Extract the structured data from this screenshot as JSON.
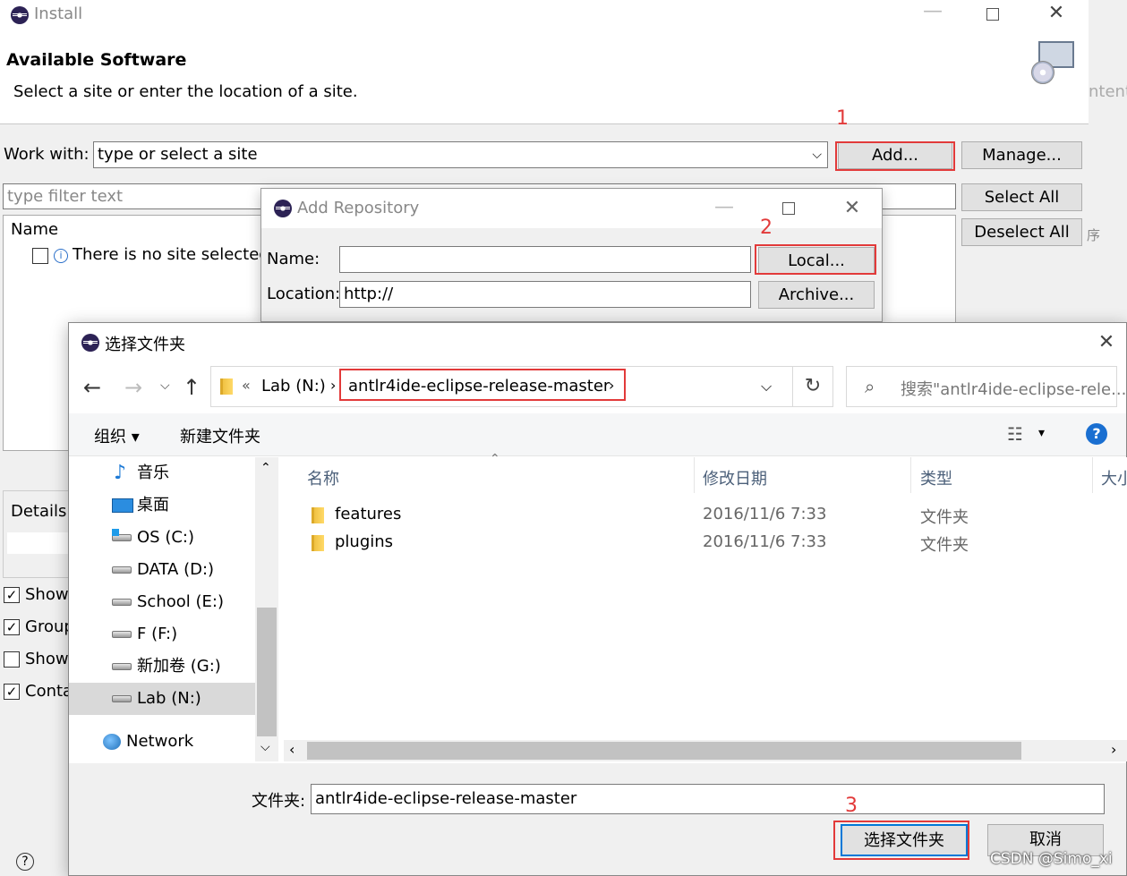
{
  "install": {
    "title": "Install",
    "heading": "Available Software",
    "subheading": "Select a site or enter the location of a site.",
    "work_with_label": "Work with:",
    "work_with_value": "type or select a site",
    "filter_placeholder": "type filter text",
    "add_label": "Add...",
    "manage_label": "Manage...",
    "select_all_label": "Select All",
    "deselect_all_label": "Deselect All",
    "tree_header": "Name",
    "tree_item": "There is no site selected.",
    "details_label": "Details",
    "options": [
      {
        "label": "Show",
        "checked": true
      },
      {
        "label": "Group",
        "checked": true
      },
      {
        "label": "Show",
        "checked": false
      },
      {
        "label": "Conta",
        "checked": true
      }
    ],
    "bg_fragment_1": "ntent",
    "bg_fragment_2": "序",
    "help_glyph": "?"
  },
  "add_repo": {
    "title": "Add Repository",
    "name_label": "Name:",
    "name_value": "",
    "location_label": "Location:",
    "location_value": "http://",
    "local_label": "Local...",
    "archive_label": "Archive..."
  },
  "picker": {
    "title": "选择文件夹",
    "breadcrumb": [
      "«",
      "Lab (N:)",
      "antlr4ide-eclipse-release-master"
    ],
    "search_placeholder": "搜索\"antlr4ide-eclipse-rele...",
    "organize_label": "组织",
    "new_folder_label": "新建文件夹",
    "nav_items": [
      {
        "label": "音乐",
        "icon": "music-icon"
      },
      {
        "label": "桌面",
        "icon": "desktop-icon"
      },
      {
        "label": "OS (C:)",
        "icon": "windows-drive-icon"
      },
      {
        "label": "DATA (D:)",
        "icon": "drive-icon"
      },
      {
        "label": "School (E:)",
        "icon": "drive-icon"
      },
      {
        "label": "F (F:)",
        "icon": "drive-icon"
      },
      {
        "label": "新加卷 (G:)",
        "icon": "drive-icon"
      },
      {
        "label": "Lab (N:)",
        "icon": "drive-icon",
        "selected": true
      }
    ],
    "network_label": "Network",
    "columns": [
      "名称",
      "修改日期",
      "类型",
      "大小"
    ],
    "files": [
      {
        "name": "features",
        "date": "2016/11/6 7:33",
        "type": "文件夹"
      },
      {
        "name": "plugins",
        "date": "2016/11/6 7:33",
        "type": "文件夹"
      }
    ],
    "folder_label": "文件夹:",
    "folder_value": "antlr4ide-eclipse-release-master",
    "select_label": "选择文件夹",
    "cancel_label": "取消"
  },
  "annotations": [
    "1",
    "2",
    "3"
  ],
  "watermark": "CSDN @Simo_xi"
}
